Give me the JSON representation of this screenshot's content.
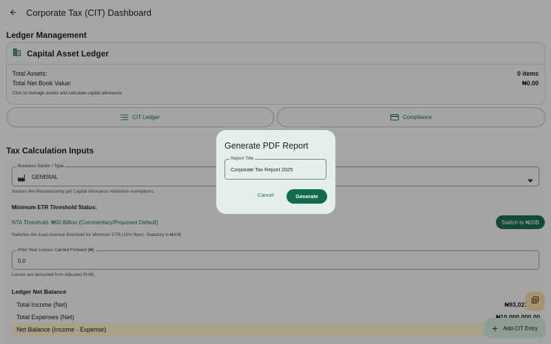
{
  "appbar": {
    "title": "Corporate Tax (CIT) Dashboard"
  },
  "ledger_section": {
    "title": "Ledger Management"
  },
  "capital_card": {
    "title": "Capital Asset Ledger",
    "total_assets_label": "Total Assets:",
    "total_assets_value": "0 items",
    "nbv_label": "Total Net Book Value:",
    "nbv_value": "₦0.00",
    "hint": "Click to manage assets and calculate capital allowance."
  },
  "buttons": {
    "cit_ledger": "CIT Ledger",
    "compliance": "Compliance"
  },
  "tax_section": {
    "title": "Tax Calculation Inputs"
  },
  "sector": {
    "legend": "Business Sector / Type",
    "value": "GENERAL",
    "hint": "Sectors like Manufacturing get Capital Allowance restriction exemptions."
  },
  "etr": {
    "label": "Minimum ETR Threshold Status:",
    "threshold": "NTA Threshold: ₦50 Billion (Commentary/Proposed Default)",
    "switch_label": "Switch to ₦20B",
    "hint": "Switches the local revenue threshold for Minimum ETR (15% floor). Statutory is ₦20B"
  },
  "losses": {
    "legend": "Prior Year Losses Carried Forward (₦)",
    "value": "0.0",
    "hint": "Losses are deducted from Adjusted Profit."
  },
  "balance": {
    "title": "Ledger Net Balance",
    "income_label": "Total Income (Net)",
    "income_value": "₦93,023,255",
    "expenses_label": "Total Expenses (Net)",
    "expenses_value": "₦10,000,000.00",
    "net_label": "Net Balance (Income - Expense)"
  },
  "fab": {
    "add_label": "Add CIT Entry"
  },
  "dialog": {
    "title": "Generate PDF Report",
    "field_legend": "Report Title",
    "field_value": "Corporate Tax Report 2025",
    "cancel_label": "Cancel",
    "generate_label": "Generate"
  },
  "colors": {
    "primary": "#126a4f",
    "dialog_bg": "#e3f0ea",
    "net_highlight": "#f7edc9",
    "fab_small": "#f3d9a8"
  }
}
